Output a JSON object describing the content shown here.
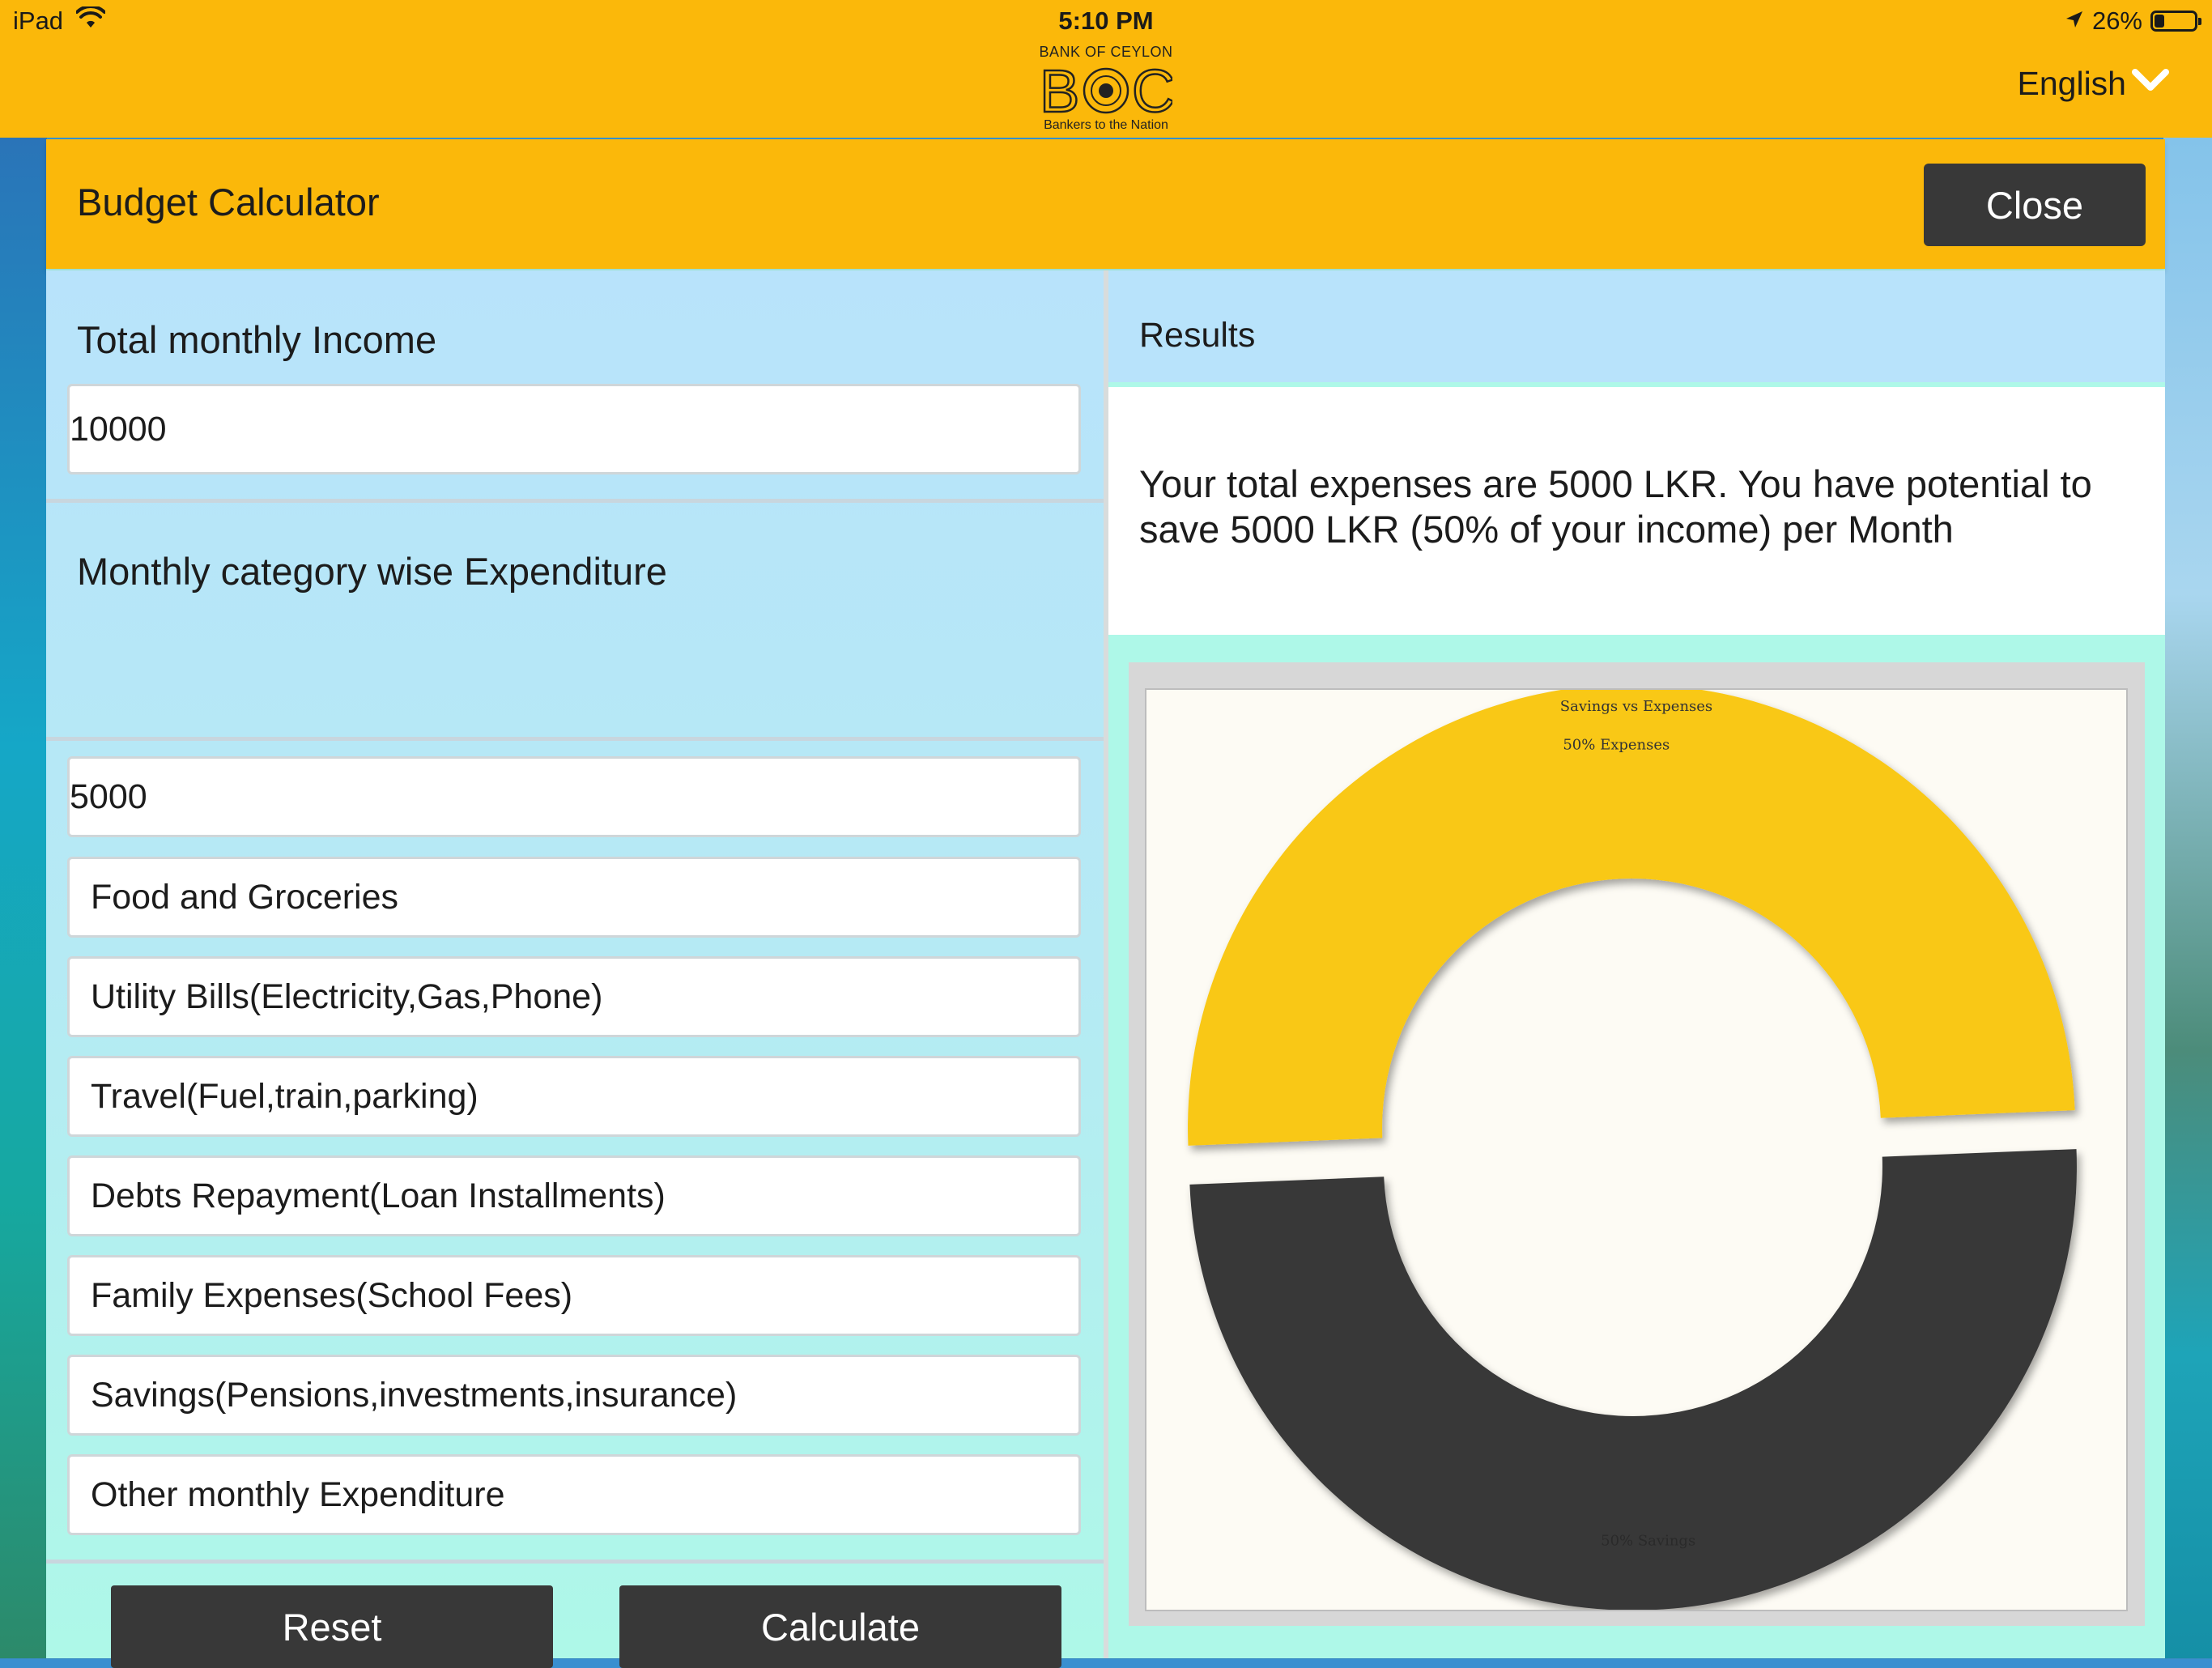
{
  "status_bar": {
    "device": "iPad",
    "time": "5:10 PM",
    "battery_percent": "26%",
    "battery_level": 0.26,
    "icons": [
      "wifi-icon",
      "location-arrow-icon",
      "battery-icon"
    ]
  },
  "header": {
    "logo": {
      "bank_name": "BANK OF CEYLON",
      "mark_text": "BOC",
      "tagline": "Bankers to the Nation"
    },
    "language": "English",
    "language_icon": "chevron-down-icon"
  },
  "modal": {
    "title": "Budget Calculator",
    "close_label": "Close"
  },
  "form": {
    "income_label": "Total monthly Income",
    "income_value": "10000",
    "expenditure_label": "Monthly category wise Expenditure",
    "expenditure_value": "5000",
    "categories": [
      "Food and Groceries",
      "Utility Bills(Electricity,Gas,Phone)",
      "Travel(Fuel,train,parking)",
      "Debts Repayment(Loan Installments)",
      "Family Expenses(School Fees)",
      "Savings(Pensions,investments,insurance)",
      "Other monthly Expenditure"
    ],
    "reset_label": "Reset",
    "calculate_label": "Calculate"
  },
  "results": {
    "label": "Results",
    "message": "Your total expenses are 5000 LKR. You have potential to save 5000 LKR (50% of your income) per Month"
  },
  "colors": {
    "accent": "#fbb80a",
    "dark_button": "#383838",
    "expenses_slice": "#f9c813",
    "savings_slice": "#383838"
  },
  "chart_data": {
    "type": "pie",
    "style": "donut",
    "title": "Savings vs Expenses",
    "slices": [
      {
        "label": "50% Expenses",
        "value": 50,
        "color": "#f9c813"
      },
      {
        "label": "50% Savings",
        "value": 50,
        "color": "#383838"
      }
    ]
  }
}
